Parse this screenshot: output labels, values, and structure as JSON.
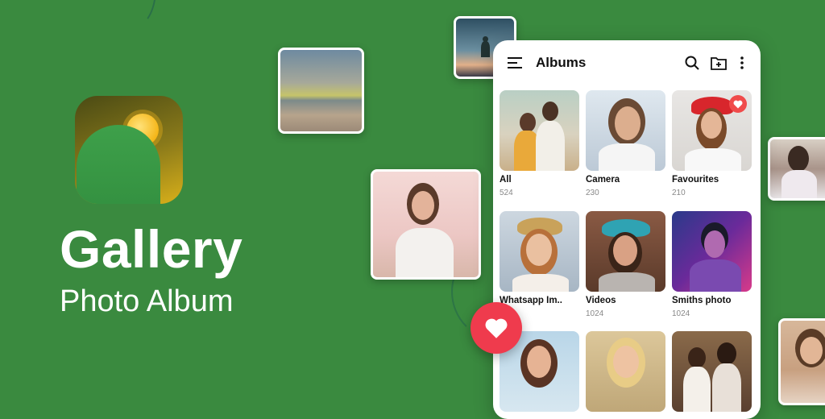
{
  "promo": {
    "headline": "Gallery",
    "subline": "Photo Album"
  },
  "app_icon": {
    "icon": "gallery-sun-hill-icon"
  },
  "phone": {
    "title": "Albums",
    "actions": [
      {
        "name": "search",
        "icon": "search-icon"
      },
      {
        "name": "new-folder",
        "icon": "folder-add-icon"
      },
      {
        "name": "more",
        "icon": "more-vertical-icon"
      }
    ],
    "albums": [
      {
        "label": "All",
        "count": "524"
      },
      {
        "label": "Camera",
        "count": "230"
      },
      {
        "label": "Favourites",
        "count": "210",
        "badge": "heart-icon"
      },
      {
        "label": "Whatsapp Im..",
        "count": ""
      },
      {
        "label": "Videos",
        "count": "1024"
      },
      {
        "label": "Smiths photo",
        "count": "1024"
      },
      {
        "label": "",
        "count": ""
      },
      {
        "label": "",
        "count": ""
      },
      {
        "label": "",
        "count": ""
      }
    ]
  },
  "colors": {
    "background": "#3a8a3f",
    "accent_heart": "#ef3b4d",
    "card": "#ffffff"
  }
}
